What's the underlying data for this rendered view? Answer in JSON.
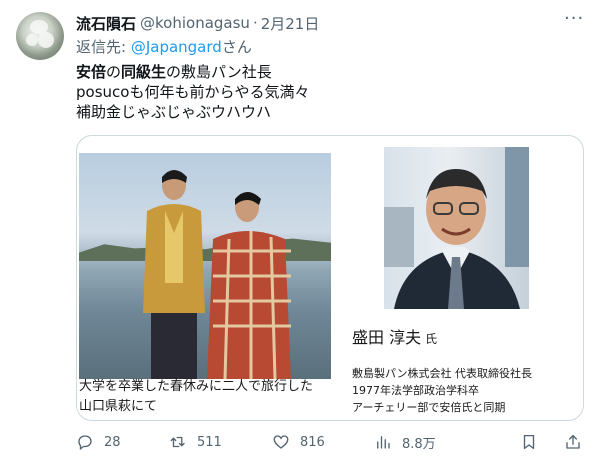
{
  "author": {
    "name": "流石隕石",
    "handle": "@kohionagasu",
    "separator": "·",
    "date": "2月21日"
  },
  "reply_to": {
    "prefix": "返信先: ",
    "mention": "@Japangard",
    "suffix": "さん"
  },
  "body": {
    "line1_a": "安倍",
    "line1_b": "の",
    "line1_c": "同級生",
    "line1_d": "の敷島パン社長",
    "line2": "posucoも何年も前からやる気満々",
    "line3": "補助金じゃぶじゃぶウハウハ"
  },
  "card": {
    "left_caption_line1": "大学を卒業した春休みに二人で旅行した",
    "left_caption_line2": "山口県萩にて",
    "right_name": "盛田 淳夫",
    "right_name_suffix": "氏",
    "right_desc_line1": "敷島製パン株式会社 代表取締役社長",
    "right_desc_line2": "1977年法学部政治学科卒",
    "right_desc_line3": "アーチェリー部で安倍氏と同期"
  },
  "actions": {
    "replies": "28",
    "retweets": "511",
    "likes": "816",
    "views": "8.8万"
  },
  "colors": {
    "text": "#0f1419",
    "secondary": "#536471",
    "link": "#1d9bf0",
    "border": "#cfd9de"
  }
}
